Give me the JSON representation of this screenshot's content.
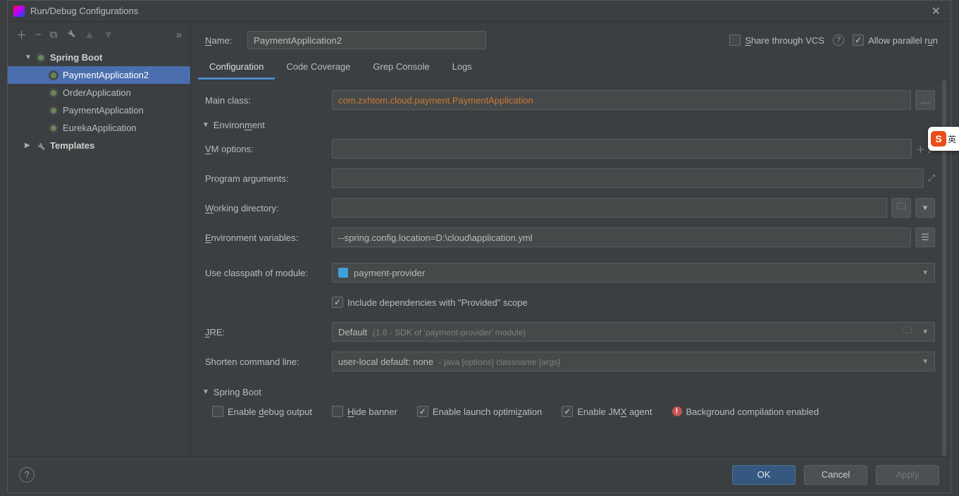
{
  "window": {
    "title": "Run/Debug Configurations"
  },
  "tree": {
    "springboot_label": "Spring Boot",
    "items": [
      "PaymentApplication2",
      "OrderApplication",
      "PaymentApplication",
      "EurekaApplication"
    ],
    "templates_label": "Templates"
  },
  "top": {
    "name_label": "Name:",
    "name_value": "PaymentApplication2",
    "share_label": "Share through VCS",
    "allow_label": "Allow parallel run"
  },
  "tabs": {
    "t0": "Configuration",
    "t1": "Code Coverage",
    "t2": "Grep Console",
    "t3": "Logs"
  },
  "form": {
    "main_class_label": "Main class:",
    "main_class_value": "com.zxhtom.cloud.payment.PaymentApplication",
    "env_section": "Environment",
    "vm_label": "VM options:",
    "vm_value": "",
    "prog_label": "Program arguments:",
    "prog_value": "",
    "work_label": "Working directory:",
    "work_value": "",
    "envvar_label": "Environment variables:",
    "envvar_value": "--spring.config.location=D:\\cloud\\application.yml",
    "module_label": "Use classpath of module:",
    "module_value": "payment-provider",
    "include_provided": "Include dependencies with \"Provided\" scope",
    "jre_label": "JRE:",
    "jre_value": "Default",
    "jre_hint": "(1.8 - SDK of 'payment-provider' module)",
    "shorten_label": "Shorten command line:",
    "shorten_value": "user-local default: none",
    "shorten_hint": "- java [options] classname [args]",
    "spring_section": "Spring Boot",
    "enable_debug": "Enable debug output",
    "hide_banner": "Hide banner",
    "enable_launch": "Enable launch optimization",
    "enable_jmx": "Enable JMX agent",
    "bg_compile": "Background compilation enabled"
  },
  "footer": {
    "ok": "OK",
    "cancel": "Cancel",
    "apply": "Apply"
  },
  "ime": {
    "letter": "S",
    "lang": "英"
  }
}
